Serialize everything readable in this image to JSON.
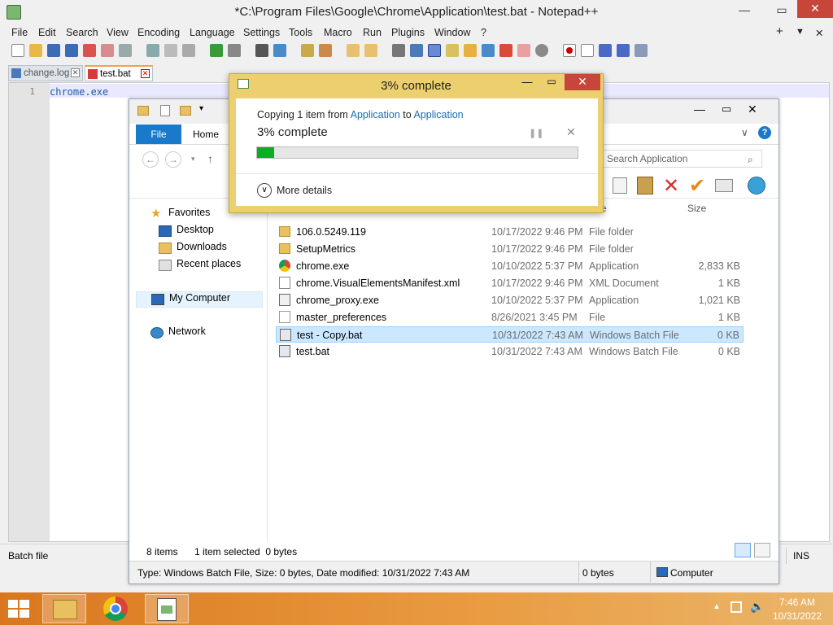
{
  "npp": {
    "title": "*C:\\Program Files\\Google\\Chrome\\Application\\test.bat - Notepad++",
    "menu": [
      "File",
      "Edit",
      "Search",
      "View",
      "Encoding",
      "Language",
      "Settings",
      "Tools",
      "Macro",
      "Run",
      "Plugins",
      "Window",
      "?"
    ],
    "tabs": [
      {
        "label": "change.log"
      },
      {
        "label": "test.bat"
      }
    ],
    "line_number": "1",
    "code": "chrome.exe",
    "status_left": "Batch file",
    "status_ins": "INS"
  },
  "explorer": {
    "ribbon_tabs": {
      "file": "File",
      "home": "Home"
    },
    "search_placeholder": "Search Application",
    "nav": {
      "favorites": "Favorites",
      "desktop": "Desktop",
      "downloads": "Downloads",
      "recent": "Recent places",
      "computer": "My Computer",
      "network": "Network"
    },
    "columns": {
      "type_tail": "e",
      "size": "Size"
    },
    "files": [
      {
        "name": "106.0.5249.119",
        "date": "10/17/2022 9:46 PM",
        "type": "File folder",
        "size": ""
      },
      {
        "name": "SetupMetrics",
        "date": "10/17/2022 9:46 PM",
        "type": "File folder",
        "size": ""
      },
      {
        "name": "chrome.exe",
        "date": "10/10/2022 5:37 PM",
        "type": "Application",
        "size": "2,833 KB"
      },
      {
        "name": "chrome.VisualElementsManifest.xml",
        "date": "10/17/2022 9:46 PM",
        "type": "XML Document",
        "size": "1 KB"
      },
      {
        "name": "chrome_proxy.exe",
        "date": "10/10/2022 5:37 PM",
        "type": "Application",
        "size": "1,021 KB"
      },
      {
        "name": "master_preferences",
        "date": "8/26/2021 3:45 PM",
        "type": "File",
        "size": "1 KB"
      },
      {
        "name": "test - Copy.bat",
        "date": "10/31/2022 7:43 AM",
        "type": "Windows Batch File",
        "size": "0 KB"
      },
      {
        "name": "test.bat",
        "date": "10/31/2022 7:43 AM",
        "type": "Windows Batch File",
        "size": "0 KB"
      }
    ],
    "status_items": "8 items",
    "status_selected": "1 item selected  0 bytes",
    "status_detail": "Type: Windows Batch File, Size: 0 bytes, Date modified: 10/31/2022 7:43 AM",
    "status_bytes": "0 bytes",
    "status_computer": "Computer"
  },
  "copy_dialog": {
    "title": "3% complete",
    "copying_prefix": "Copying 1 item from ",
    "from": "Application",
    "to_word": " to ",
    "to": "Application",
    "percent_text": "3% complete",
    "progress": 0.03,
    "more_details": "More details"
  },
  "taskbar": {
    "time": "7:46 AM",
    "date": "10/31/2022"
  },
  "colors": {
    "accent_blue": "#1979ca",
    "progress_green": "#06b025",
    "dialog_frame": "#eccf6e",
    "close_red": "#c7463a",
    "taskbar_orange": "#d9771e"
  }
}
